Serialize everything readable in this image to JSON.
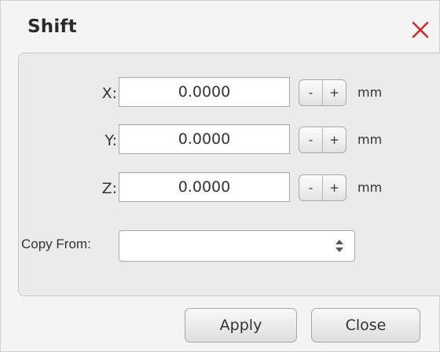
{
  "dialog": {
    "title": "Shift",
    "close_icon": "close-icon",
    "colors": {
      "close_icon": "#cc2a2a",
      "background": "#f4f4f4",
      "panel": "#ebebeb"
    }
  },
  "fields": [
    {
      "label": "X:",
      "value": "0.0000",
      "minus": "-",
      "plus": "+",
      "unit": "mm"
    },
    {
      "label": "Y:",
      "value": "0.0000",
      "minus": "-",
      "plus": "+",
      "unit": "mm"
    },
    {
      "label": "Z:",
      "value": "0.0000",
      "minus": "-",
      "plus": "+",
      "unit": "mm"
    }
  ],
  "copy_from": {
    "label": "Copy From:",
    "selected": "",
    "icon": "up-down-arrows-icon"
  },
  "buttons": {
    "apply": "Apply",
    "close": "Close"
  }
}
